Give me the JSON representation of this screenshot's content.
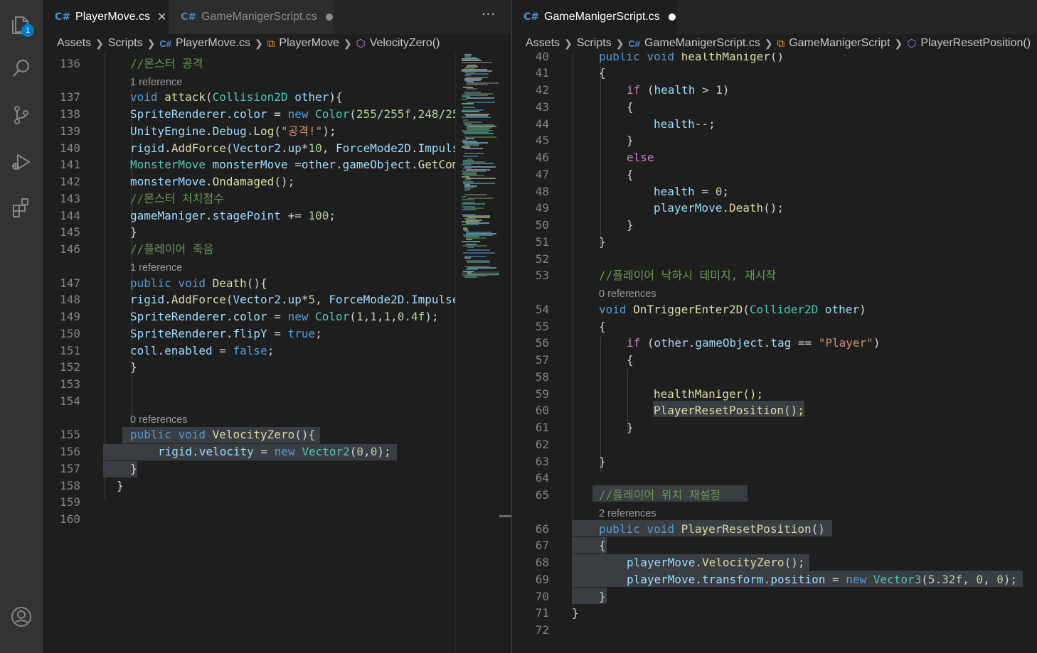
{
  "activity_bar": {
    "explorer_badge": "1",
    "icons": [
      "files-icon",
      "search-icon",
      "source-control-icon",
      "run-debug-icon",
      "extensions-icon",
      "account-icon"
    ]
  },
  "left_editor": {
    "tabs": [
      {
        "label": "PlayerMove.cs",
        "active": true,
        "icon": "csharp-file-icon"
      },
      {
        "label": "GameManigerScript.cs",
        "active": false,
        "icon": "csharp-file-icon",
        "dirty": true
      }
    ],
    "more_actions": "···",
    "breadcrumb": [
      "Assets",
      "Scripts",
      "PlayerMove.cs",
      "PlayerMove",
      "VelocityZero()"
    ],
    "lines": [
      {
        "no": "136",
        "text": "//몬스터 공격"
      },
      {
        "lens": "1 reference"
      },
      {
        "no": "137",
        "text": "void attack(Collision2D other){"
      },
      {
        "no": "138",
        "text": "SpriteRenderer.color = new Color(255/255f,248/25"
      },
      {
        "no": "139",
        "text": "UnityEngine.Debug.Log(\"공격!\");"
      },
      {
        "no": "140",
        "text": "rigid.AddForce(Vector2.up*10, ForceMode2D.Impuls"
      },
      {
        "no": "141",
        "text": "MonsterMove monsterMove =other.gameObject.GetCom"
      },
      {
        "no": "142",
        "text": "monsterMove.Ondamaged();"
      },
      {
        "no": "143",
        "text": "//몬스터 처치점수"
      },
      {
        "no": "144",
        "text": "gameManiger.stagePoint += 100;"
      },
      {
        "no": "145",
        "text": "}"
      },
      {
        "no": "146",
        "text": "//플레이어 죽음"
      },
      {
        "lens": "1 reference"
      },
      {
        "no": "147",
        "text": "public void Death(){"
      },
      {
        "no": "148",
        "text": "rigid.AddForce(Vector2.up*5, ForceMode2D.Impulse"
      },
      {
        "no": "149",
        "text": "SpriteRenderer.color = new Color(1,1,1,0.4f);"
      },
      {
        "no": "150",
        "text": "SpriteRenderer.flipY = true;"
      },
      {
        "no": "151",
        "text": "coll.enabled = false;"
      },
      {
        "no": "152",
        "text": "}"
      },
      {
        "no": "153",
        "text": ""
      },
      {
        "no": "154",
        "text": ""
      },
      {
        "lens": "0 references"
      },
      {
        "no": "155",
        "text": "public void VelocityZero(){"
      },
      {
        "no": "156",
        "text": "rigid.velocity = new Vector2(0,0);"
      },
      {
        "no": "157",
        "text": "}"
      },
      {
        "no": "158",
        "text": "}"
      },
      {
        "no": "159",
        "text": ""
      },
      {
        "no": "160",
        "text": ""
      }
    ]
  },
  "right_editor": {
    "tabs": [
      {
        "label": "GameManigerScript.cs",
        "active": true,
        "icon": "csharp-file-icon",
        "dirty": true
      }
    ],
    "breadcrumb": [
      "Assets",
      "Scripts",
      "GameManigerScript.cs",
      "GameManigerScript",
      "PlayerResetPosition()"
    ],
    "lines": [
      {
        "no": "40",
        "text": "public void healthManiger()"
      },
      {
        "no": "41",
        "text": "{"
      },
      {
        "no": "42",
        "text": "if (health > 1)"
      },
      {
        "no": "43",
        "text": "{"
      },
      {
        "no": "44",
        "text": "health--;"
      },
      {
        "no": "45",
        "text": "}"
      },
      {
        "no": "46",
        "text": "else"
      },
      {
        "no": "47",
        "text": "{"
      },
      {
        "no": "48",
        "text": "health = 0;"
      },
      {
        "no": "49",
        "text": "playerMove.Death();"
      },
      {
        "no": "50",
        "text": "}"
      },
      {
        "no": "51",
        "text": "}"
      },
      {
        "no": "52",
        "text": ""
      },
      {
        "no": "53",
        "text": "//플레이어 낙하시 데미지, 재시작"
      },
      {
        "lens": "0 references"
      },
      {
        "no": "54",
        "text": "void OnTriggerEnter2D(Collider2D other)"
      },
      {
        "no": "55",
        "text": "{"
      },
      {
        "no": "56",
        "text": "if (other.gameObject.tag == \"Player\")"
      },
      {
        "no": "57",
        "text": "{"
      },
      {
        "no": "58",
        "text": ""
      },
      {
        "no": "59",
        "text": "healthManiger();"
      },
      {
        "no": "60",
        "text": "PlayerResetPosition();"
      },
      {
        "no": "61",
        "text": "}"
      },
      {
        "no": "62",
        "text": ""
      },
      {
        "no": "63",
        "text": "}"
      },
      {
        "no": "64",
        "text": ""
      },
      {
        "no": "65",
        "text": "//플레이어 위치 재설정"
      },
      {
        "lens": "2 references"
      },
      {
        "no": "66",
        "text": "public void PlayerResetPosition()"
      },
      {
        "no": "67",
        "text": "{"
      },
      {
        "no": "68",
        "text": "playerMove.VelocityZero();"
      },
      {
        "no": "69",
        "text": "playerMove.transform.position = new Vector3(5.32f, 0, 0);"
      },
      {
        "no": "70",
        "text": "}"
      },
      {
        "no": "71",
        "text": "}"
      },
      {
        "no": "72",
        "text": ""
      }
    ]
  },
  "colors": {
    "editor_bg": "#1e1e1e",
    "activity_bar_bg": "#333333",
    "keyword": "#569cd6",
    "type": "#4ec9b0",
    "function": "#dcdcaa",
    "variable": "#9cdcfe",
    "number": "#b5cea8",
    "string": "#ce9178",
    "comment": "#6a9955",
    "control": "#c586c0",
    "badge": "#007acc"
  }
}
